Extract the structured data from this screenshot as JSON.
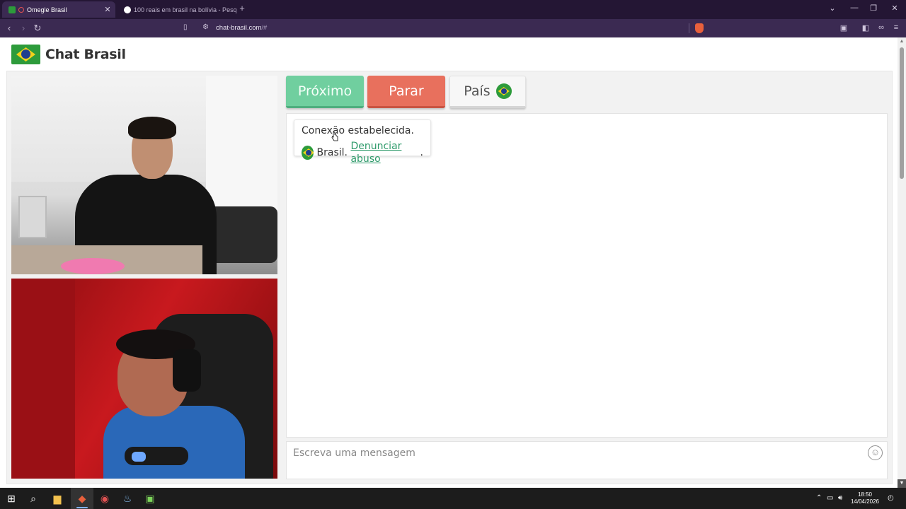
{
  "browser": {
    "tabs": [
      {
        "title": "Omegle Brasil",
        "active": true
      },
      {
        "title": "100 reais em brasil na bolívia - Pesq",
        "active": false
      }
    ],
    "url_host": "chat-brasil.com",
    "url_path": "/#"
  },
  "site": {
    "title": "Chat Brasil"
  },
  "controls": {
    "next_label": "Próximo",
    "stop_label": "Parar",
    "country_label": "País"
  },
  "chat": {
    "status": "Conexão estabelecida.",
    "country": "Brasil.",
    "report_link": "Denunciar abuso",
    "report_suffix": "."
  },
  "input": {
    "placeholder": "Escreva uma mensagem"
  },
  "taskbar": {
    "time": "18:50",
    "date": "14/04/2026"
  },
  "colors": {
    "next": "#70cf9f",
    "stop": "#e8705d",
    "link": "#2e9a6a",
    "browser_chrome": "#3b2a52"
  }
}
